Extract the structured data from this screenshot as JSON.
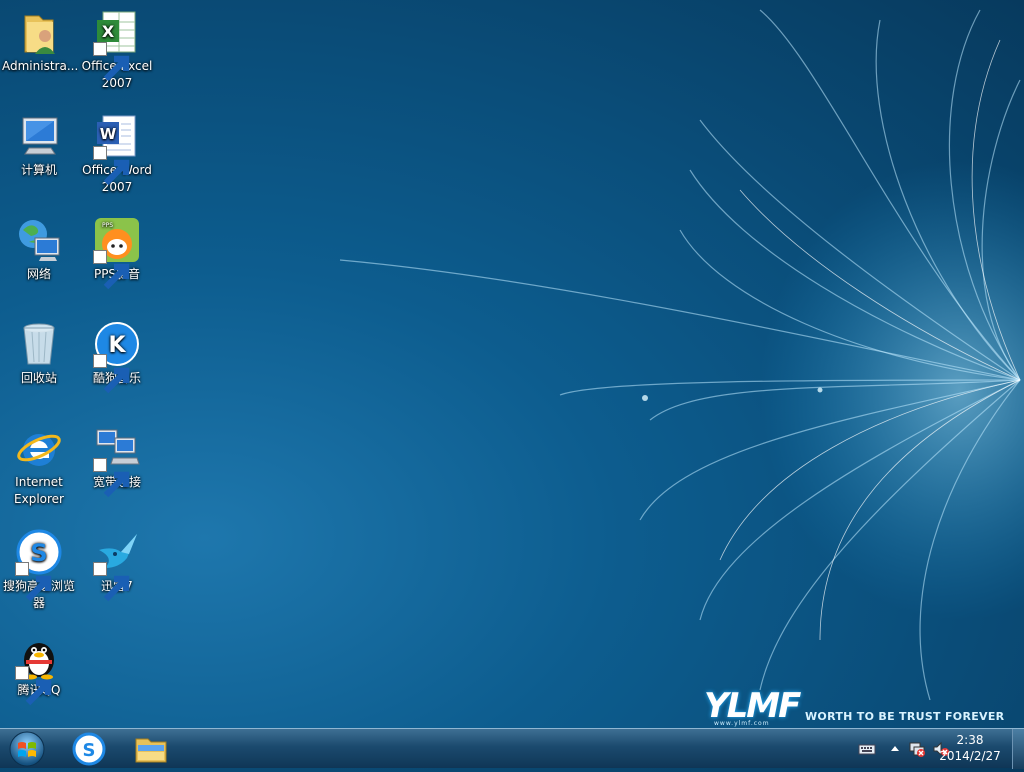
{
  "desktop": {
    "icons": [
      {
        "id": "administrator",
        "label": "Administra...",
        "icon": "folder-user-icon",
        "shortcut": false
      },
      {
        "id": "excel",
        "label": "Office Excel 2007",
        "icon": "excel-icon",
        "shortcut": true
      },
      {
        "id": "computer",
        "label": "计算机",
        "icon": "computer-icon",
        "shortcut": false
      },
      {
        "id": "word",
        "label": "Office Word 2007",
        "icon": "word-icon",
        "shortcut": true
      },
      {
        "id": "network",
        "label": "网络",
        "icon": "network-icon",
        "shortcut": false
      },
      {
        "id": "pps",
        "label": "PPS影音",
        "icon": "pps-icon",
        "shortcut": true
      },
      {
        "id": "recycle",
        "label": "回收站",
        "icon": "recycle-bin-icon",
        "shortcut": false
      },
      {
        "id": "kugou",
        "label": "酷狗音乐",
        "icon": "kugou-icon",
        "shortcut": true
      },
      {
        "id": "ie",
        "label": "Internet Explorer",
        "icon": "internet-explorer-icon",
        "shortcut": false
      },
      {
        "id": "broadband",
        "label": "宽带连接",
        "icon": "broadband-icon",
        "shortcut": true
      },
      {
        "id": "sogou",
        "label": "搜狗高速浏览器",
        "icon": "sogou-browser-icon",
        "shortcut": true
      },
      {
        "id": "xunlei",
        "label": "迅雷7",
        "icon": "xunlei-icon",
        "shortcut": true
      },
      {
        "id": "qq",
        "label": "腾讯QQ",
        "icon": "qq-icon",
        "shortcut": true
      }
    ]
  },
  "brand": {
    "logo": "YLMF",
    "url": "www.ylmf.com",
    "tagline": "WORTH TO BE TRUST FOREVER"
  },
  "taskbar": {
    "start_icon": "windows-start-icon",
    "pinned": [
      {
        "id": "sogou",
        "icon": "sogou-browser-icon"
      },
      {
        "id": "explorer",
        "icon": "file-explorer-icon"
      }
    ],
    "tray_icons": [
      "keyboard-icon",
      "tray-arrow-icon",
      "network-status-icon",
      "volume-muted-icon"
    ],
    "time": "2:38",
    "date": "2014/2/27"
  },
  "colors": {
    "wallpaper": "#0d5d8f",
    "taskbar": "#1b4a6e"
  }
}
